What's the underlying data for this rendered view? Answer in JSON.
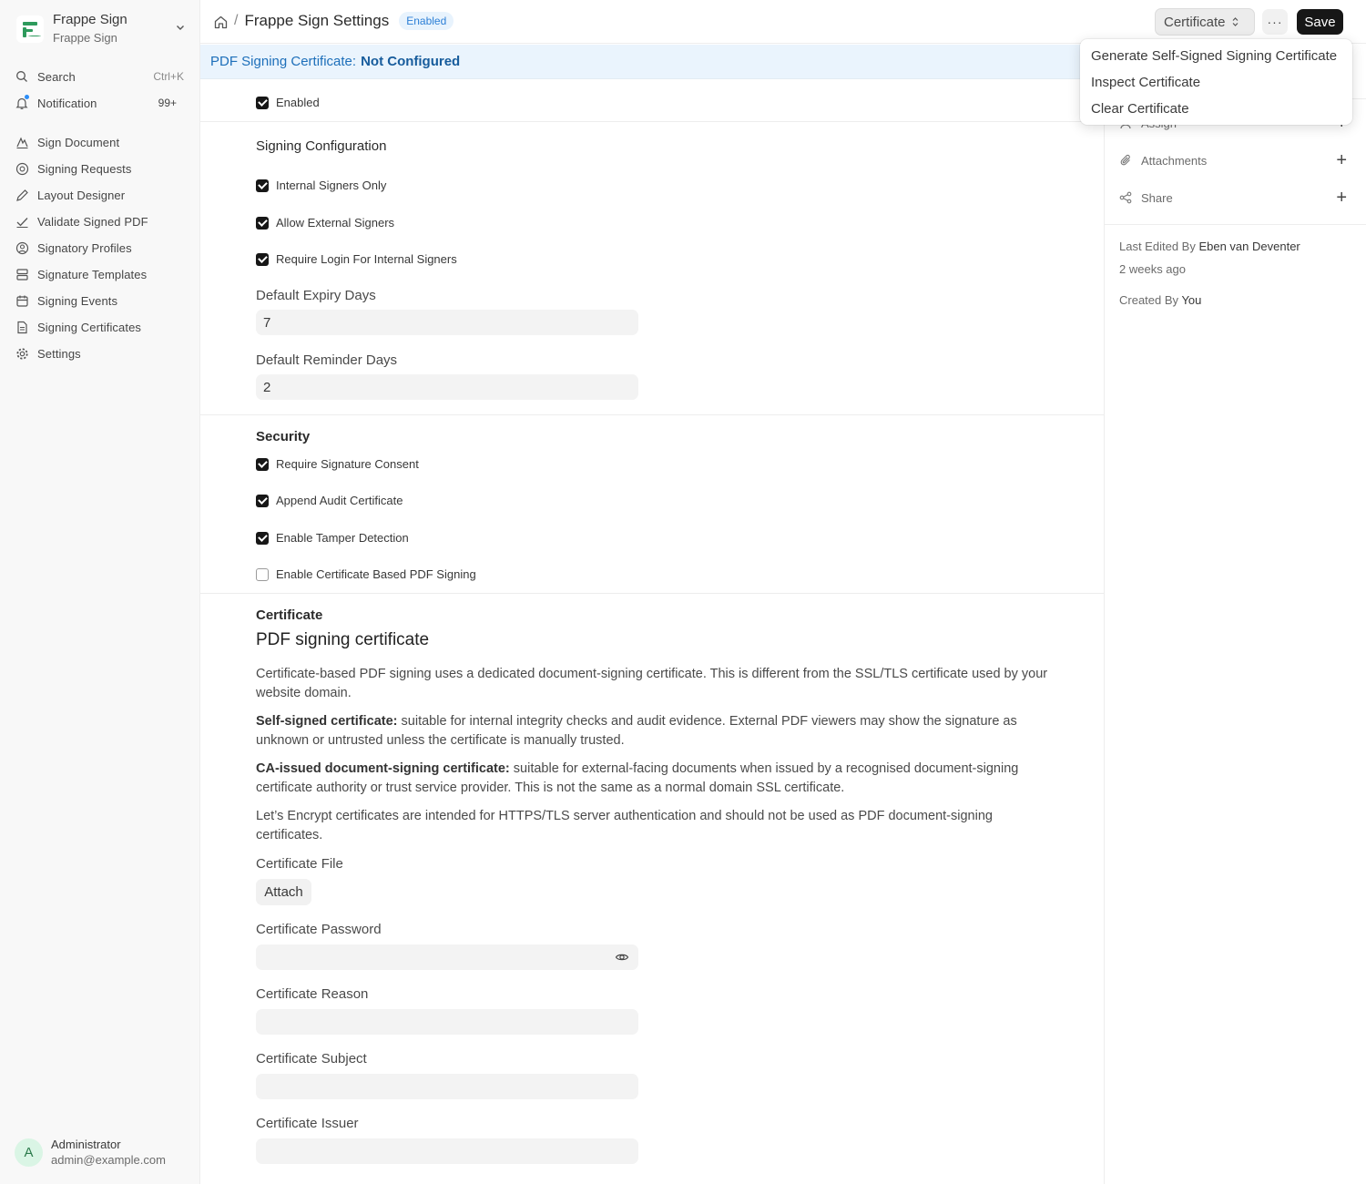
{
  "sidebar": {
    "brand": {
      "name": "Frappe Sign",
      "subtitle": "Frappe Sign"
    },
    "search": {
      "label": "Search",
      "shortcut": "Ctrl+K"
    },
    "notification": {
      "label": "Notification",
      "count": "99+"
    },
    "items": [
      {
        "label": "Sign Document",
        "icon": "signature-icon"
      },
      {
        "label": "Signing Requests",
        "icon": "help-circle-icon"
      },
      {
        "label": "Layout Designer",
        "icon": "pen-icon"
      },
      {
        "label": "Validate Signed PDF",
        "icon": "check-icon"
      },
      {
        "label": "Signatory Profiles",
        "icon": "user-circle-icon"
      },
      {
        "label": "Signature Templates",
        "icon": "template-icon"
      },
      {
        "label": "Signing Events",
        "icon": "calendar-icon"
      },
      {
        "label": "Signing Certificates",
        "icon": "file-text-icon"
      },
      {
        "label": "Settings",
        "icon": "gear-icon"
      }
    ],
    "user": {
      "initial": "A",
      "name": "Administrator",
      "email": "admin@example.com"
    }
  },
  "header": {
    "title": "Frappe Sign Settings",
    "status_badge": "Enabled",
    "certificate_button": "Certificate",
    "more_button": "···",
    "save_button": "Save"
  },
  "banner": {
    "label": "PDF Signing Certificate:",
    "value": "Not Configured"
  },
  "form": {
    "enabled_label": "Enabled",
    "signing_configuration": {
      "title": "Signing Configuration",
      "internal_signers_only": "Internal Signers Only",
      "allow_external_signers": "Allow External Signers",
      "require_login_internal": "Require Login For Internal Signers",
      "default_expiry_label": "Default Expiry Days",
      "default_expiry_value": "7",
      "default_reminder_label": "Default Reminder Days",
      "default_reminder_value": "2"
    },
    "security": {
      "title": "Security",
      "require_signature_consent": "Require Signature Consent",
      "append_audit_certificate": "Append Audit Certificate",
      "enable_tamper_detection": "Enable Tamper Detection",
      "enable_certificate_pdf_signing": "Enable Certificate Based PDF Signing"
    },
    "certificate": {
      "section_title": "Certificate",
      "heading": "PDF signing certificate",
      "para1": "Certificate-based PDF signing uses a dedicated document-signing certificate. This is different from the SSL/TLS certificate used by your website domain.",
      "para2_bold": "Self-signed certificate:",
      "para2_rest": " suitable for internal integrity checks and audit evidence. External PDF viewers may show the signature as unknown or untrusted unless the certificate is manually trusted.",
      "para3_bold": "CA-issued document-signing certificate:",
      "para3_rest": " suitable for external-facing documents when issued by a recognised document-signing certificate authority or trust service provider. This is not the same as a normal domain SSL certificate.",
      "para4": "Let’s Encrypt certificates are intended for HTTPS/TLS server authentication and should not be used as PDF document-signing certificates.",
      "file_label": "Certificate File",
      "attach_button": "Attach",
      "password_label": "Certificate Password",
      "reason_label": "Certificate Reason",
      "subject_label": "Certificate Subject",
      "issuer_label": "Certificate Issuer"
    }
  },
  "right_sidebar": {
    "assign": "Assign",
    "attachments": "Attachments",
    "share": "Share",
    "last_edited_prefix": "Last Edited By",
    "last_edited_by": "Eben van Deventer",
    "last_edited_when": "2 weeks ago",
    "created_prefix": "Created By",
    "created_by": "You"
  },
  "dropdown": {
    "items": [
      "Generate Self-Signed Signing Certificate",
      "Inspect Certificate",
      "Clear Certificate"
    ]
  },
  "checkbox_states": {
    "enabled": true,
    "internal_signers_only": true,
    "allow_external_signers": true,
    "require_login_internal": true,
    "require_signature_consent": true,
    "append_audit_certificate": true,
    "enable_tamper_detection": true,
    "enable_certificate_pdf_signing": false
  },
  "colors": {
    "accent": "#171717",
    "banner_text": "#1d6fba",
    "badge": "#2c7fd6",
    "brand_green": "#2e9a5c"
  }
}
